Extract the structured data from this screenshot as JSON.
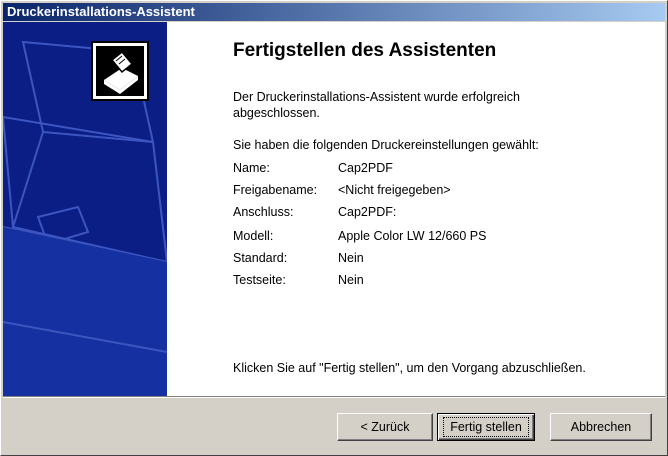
{
  "window": {
    "title": "Druckerinstallations-Assistent"
  },
  "main": {
    "heading": "Fertigstellen des Assistenten",
    "intro_line1": "Der Druckerinstallations-Assistent wurde erfolgreich",
    "intro_line2": "abgeschlossen.",
    "settings_intro": "Sie haben die folgenden Druckereinstellungen gewählt:",
    "settings": [
      {
        "label": "Name:",
        "value": "Cap2PDF"
      },
      {
        "label": "Freigabename:",
        "value": "<Nicht freigegeben>"
      },
      {
        "label": "Anschluss:",
        "value": "Cap2PDF:"
      },
      {
        "label": "Modell:",
        "value": "Apple Color LW 12/660 PS"
      },
      {
        "label": "Standard:",
        "value": "Nein"
      },
      {
        "label": "Testseite:",
        "value": "Nein"
      }
    ],
    "footer_text": "Klicken Sie auf \"Fertig stellen\", um den Vorgang abzuschließen."
  },
  "sidebar": {
    "icon": "printer-wizard-icon",
    "color": "#0a1e86"
  },
  "buttons": {
    "back": "< Zurück",
    "finish": "Fertig stellen",
    "cancel": "Abbrechen"
  }
}
